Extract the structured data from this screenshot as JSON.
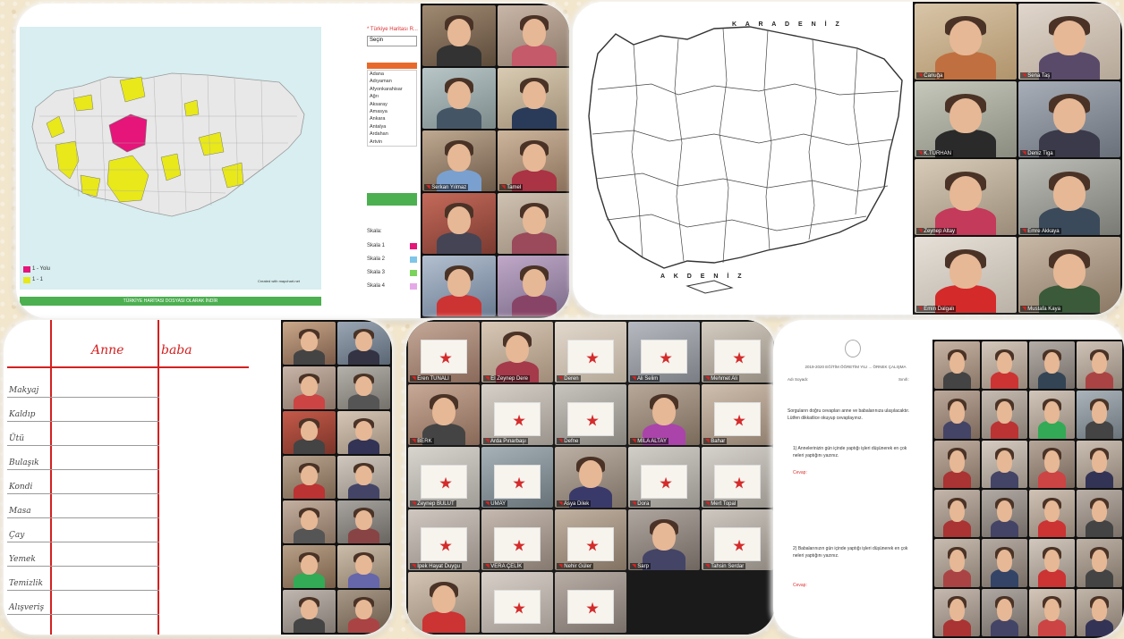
{
  "panel1": {
    "required_label": "* Türkiye Haritası R...",
    "select_value": "Seçin",
    "list_header": "",
    "cities": [
      "Adana",
      "Adıyaman",
      "Afyonkarahisar",
      "Ağrı",
      "Aksaray",
      "Amasya",
      "Ankara",
      "Antalya",
      "Ardahan",
      "Artvin"
    ],
    "map_footer_button": "TÜRKİYE HARİTASI DOSYASI OLARAK İNDİR",
    "credit": "Created with mapchart.net",
    "legend": [
      {
        "color": "#e6157a",
        "label": "1 - Yolu"
      },
      {
        "color": "#e8e81a",
        "label": "1 - 1"
      }
    ],
    "scale_label": "Skala:",
    "scale_options": [
      "Skala 1",
      "Skala 2",
      "Skala 3",
      "Skala 4"
    ],
    "participants": [
      {
        "name": "",
        "a": "#a08a72",
        "b": "#5c4a3a",
        "c": "#333"
      },
      {
        "name": "",
        "a": "#c8b6a8",
        "b": "#8e7a6a",
        "c": "#c45a6a"
      },
      {
        "name": "",
        "a": "#b9c6c8",
        "b": "#7c8a8a",
        "c": "#445566"
      },
      {
        "name": "",
        "a": "#d9cbb3",
        "b": "#a08e76",
        "c": "#2a3b5a"
      },
      {
        "name": "Serkan Yılmaz",
        "a": "#bfa992",
        "b": "#6d5a48",
        "c": "#7aa0d0"
      },
      {
        "name": "Tamel",
        "a": "#cdb59c",
        "b": "#8a705a",
        "c": "#aa3344"
      },
      {
        "name": "",
        "a": "#c46a5a",
        "b": "#7a3a30",
        "c": "#445"
      },
      {
        "name": "",
        "a": "#d0c2b2",
        "b": "#9a8a7a",
        "c": "#9a4a5a"
      },
      {
        "name": "",
        "a": "#b3c0d0",
        "b": "#6a7a90",
        "c": "#cc3333"
      },
      {
        "name": "",
        "a": "#c0a8c8",
        "b": "#7a6a88",
        "c": "#884466"
      }
    ]
  },
  "panel2": {
    "karadeniz": "K A R A D E N İ Z",
    "akdeniz": "A K D E N İ Z",
    "participants": [
      {
        "name": "Canuğa",
        "a": "#d8c5a8",
        "b": "#b0946c",
        "c": "#c07040"
      },
      {
        "name": "Sena Taş",
        "a": "#e0d6cc",
        "b": "#b6a898",
        "c": "#5a4a6a"
      },
      {
        "name": "K.TURHAN",
        "a": "#c6c8bc",
        "b": "#8a8c80",
        "c": "#2a2a2a"
      },
      {
        "name": "Deniz Tiga",
        "a": "#a8aeb8",
        "b": "#6a707a",
        "c": "#3a3a4a"
      },
      {
        "name": "Zeynep Altay",
        "a": "#d8ccb8",
        "b": "#9a8c78",
        "c": "#c43a5a"
      },
      {
        "name": "Emre Akkaya",
        "a": "#bdbdb8",
        "b": "#7a7a74",
        "c": "#3a4a5a"
      },
      {
        "name": "Emin Dalgalı",
        "a": "#e6e0d8",
        "b": "#bab2a6",
        "c": "#d42a2a"
      },
      {
        "name": "Mustafa Kaya",
        "a": "#c8b8a6",
        "b": "#8a7864",
        "c": "#3a5a3a"
      }
    ]
  },
  "panel3": {
    "col1": "Anne",
    "col2": "baba",
    "rows": [
      "Makyaj",
      "Kaldıp",
      "Ütü",
      "Bulaşık",
      "Kondi",
      "Masa",
      "Çay",
      "Yemek",
      "Temizlik",
      "Alışveriş"
    ],
    "participants": [
      {
        "a": "#c9a88a",
        "b": "#7a5a48",
        "c": "#444"
      },
      {
        "a": "#9aa6b4",
        "b": "#5a6674",
        "c": "#334"
      },
      {
        "a": "#c8b4a8",
        "b": "#8a7468",
        "c": "#c44"
      },
      {
        "a": "#b4b0aa",
        "b": "#74706a",
        "c": "#555"
      },
      {
        "a": "#c45a4a",
        "b": "#7a3428",
        "c": "#444"
      },
      {
        "a": "#d6c6b6",
        "b": "#9a8a7a",
        "c": "#335"
      },
      {
        "a": "#b8a490",
        "b": "#7a6450",
        "c": "#b33"
      },
      {
        "a": "#d0c8be",
        "b": "#948c82",
        "c": "#446"
      },
      {
        "a": "#c4b0a0",
        "b": "#846e5e",
        "c": "#555"
      },
      {
        "a": "#a8a4a0",
        "b": "#686460",
        "c": "#844"
      },
      {
        "a": "#b8a088",
        "b": "#785e48",
        "c": "#3a5"
      },
      {
        "a": "#ccbcaa",
        "b": "#8c7c6a",
        "c": "#66a"
      },
      {
        "a": "#c0b8b0",
        "b": "#807870",
        "c": "#444"
      },
      {
        "a": "#a89888",
        "b": "#6a5a4a",
        "c": "#a44"
      }
    ]
  },
  "panel4": {
    "participants": [
      {
        "name": "Eren TUNALI",
        "a": "#c4a898",
        "b": "#8a6a5a",
        "c": "#d04a4a",
        "paper": true
      },
      {
        "name": "El Zeynep Dere",
        "a": "#d8c8b6",
        "b": "#a08c78",
        "c": "#a43a4a",
        "paper": false
      },
      {
        "name": "Deren",
        "a": "#e2d8cc",
        "b": "#b4a898",
        "c": "#c44",
        "paper": true
      },
      {
        "name": "Ali Selim",
        "a": "#b6bac0",
        "b": "#7a7e84",
        "c": "#446",
        "paper": true
      },
      {
        "name": "Mehmet Ali",
        "a": "#d4ccc0",
        "b": "#948c80",
        "c": "#a33",
        "paper": true
      },
      {
        "name": "BERK",
        "a": "#c8a896",
        "b": "#886856",
        "c": "#444",
        "paper": false
      },
      {
        "name": "Arda Pınarbaşı",
        "a": "#d6d0c8",
        "b": "#9a948c",
        "c": "#3a7a3a",
        "paper": true
      },
      {
        "name": "Defne",
        "a": "#c8c4be",
        "b": "#88847e",
        "c": "#446",
        "paper": true
      },
      {
        "name": "MİLA ALTAY",
        "a": "#b8a89a",
        "b": "#7a6a5a",
        "c": "#a4a",
        "paper": false
      },
      {
        "name": "Bahar",
        "a": "#d0c0b0",
        "b": "#907e6e",
        "c": "#a33",
        "paper": true
      },
      {
        "name": "Zeynep BULUT",
        "a": "#d8d4ce",
        "b": "#a09c96",
        "c": "#c33",
        "paper": true
      },
      {
        "name": "UMAY",
        "a": "#a6b2b8",
        "b": "#667278",
        "c": "#345",
        "paper": true
      },
      {
        "name": "Asya Dilek",
        "a": "#bcb0a4",
        "b": "#7c7064",
        "c": "#3a3a6a",
        "paper": false
      },
      {
        "name": "Dora",
        "a": "#d2cec8",
        "b": "#96928c",
        "c": "#b33",
        "paper": true
      },
      {
        "name": "Mert Topal",
        "a": "#d6d2cc",
        "b": "#9a968e",
        "c": "#a33",
        "paper": true
      },
      {
        "name": "İpek Hayat Duygu",
        "a": "#d0c8c0",
        "b": "#948c84",
        "c": "#b33",
        "paper": true
      },
      {
        "name": "VERA ÇELİK",
        "a": "#c6bab0",
        "b": "#867a70",
        "c": "#557",
        "paper": true
      },
      {
        "name": "Nehir Güler",
        "a": "#c2b2a2",
        "b": "#827262",
        "c": "#4a6a8a",
        "paper": true
      },
      {
        "name": "Sarp",
        "a": "#b0a6a0",
        "b": "#706660",
        "c": "#446",
        "paper": false
      },
      {
        "name": "Tahsin Serdar",
        "a": "#cfc8c0",
        "b": "#8f8880",
        "c": "#a33",
        "paper": true
      },
      {
        "name": "",
        "a": "#d4c4b4",
        "b": "#948474",
        "c": "#c33",
        "paper": false
      },
      {
        "name": "",
        "a": "#d8d0c8",
        "b": "#a09890",
        "c": "#a33",
        "paper": true
      },
      {
        "name": "",
        "a": "#b8aea6",
        "b": "#7a706a",
        "c": "#446",
        "paper": true
      }
    ]
  },
  "panel5": {
    "doc_title": "2019-2020 EĞİTİM ÖĞRETİM YILI ... ÖRNEK ÇALIŞMA",
    "doc_meta_left": "Adı Soyadı:",
    "doc_meta_right": "Sınıfı:",
    "instruction": "Sorguların doğru cevapları anne ve babalarınıza ulaşılacaktır. Lütfen dikkatlice okuyup cevaplayınız.",
    "q1": "1) Annelerinizin gün içinde yaptığı işleri düşünerek en çok neleri yaptığını yazınız.",
    "q1_answer": "Cevap:",
    "q2": "2) Babalarınızın gün içinde yaptığı işleri düşünerek en çok neleri yaptığını yazınız.",
    "q2_answer": "Cevap:",
    "participants": [
      {
        "a": "#c8b4a4",
        "b": "#8a7666",
        "c": "#444"
      },
      {
        "a": "#d4c8bc",
        "b": "#98887a",
        "c": "#c33"
      },
      {
        "a": "#b4aca6",
        "b": "#746c66",
        "c": "#345"
      },
      {
        "a": "#cfc2b6",
        "b": "#8f8276",
        "c": "#a44"
      },
      {
        "a": "#bca89a",
        "b": "#7c685a",
        "c": "#446"
      },
      {
        "a": "#c6bcb2",
        "b": "#867c72",
        "c": "#b33"
      },
      {
        "a": "#d2c6ba",
        "b": "#92867a",
        "c": "#3a5"
      },
      {
        "a": "#aab4ba",
        "b": "#6a747a",
        "c": "#444"
      },
      {
        "a": "#c0aea0",
        "b": "#806e60",
        "c": "#a33"
      },
      {
        "a": "#d6ccc2",
        "b": "#968c82",
        "c": "#446"
      },
      {
        "a": "#b6a69a",
        "b": "#76665a",
        "c": "#c44"
      },
      {
        "a": "#ccc0b4",
        "b": "#8c8074",
        "c": "#335"
      },
      {
        "a": "#c4b6aa",
        "b": "#84766a",
        "c": "#a33"
      },
      {
        "a": "#b2aaa4",
        "b": "#726a64",
        "c": "#446"
      },
      {
        "a": "#d0c2b4",
        "b": "#908274",
        "c": "#c33"
      },
      {
        "a": "#bab0a8",
        "b": "#7a7068",
        "c": "#444"
      },
      {
        "a": "#c8bcb0",
        "b": "#887c70",
        "c": "#a44"
      },
      {
        "a": "#b6aca4",
        "b": "#766c64",
        "c": "#346"
      },
      {
        "a": "#d2c8be",
        "b": "#92887e",
        "c": "#c33"
      },
      {
        "a": "#beb2a6",
        "b": "#7e7266",
        "c": "#444"
      },
      {
        "a": "#c6bab0",
        "b": "#867a70",
        "c": "#a33"
      },
      {
        "a": "#b0a8a2",
        "b": "#706862",
        "c": "#446"
      },
      {
        "a": "#d4c6b8",
        "b": "#948678",
        "c": "#c44"
      },
      {
        "a": "#c2b6aa",
        "b": "#82766a",
        "c": "#335"
      }
    ]
  }
}
